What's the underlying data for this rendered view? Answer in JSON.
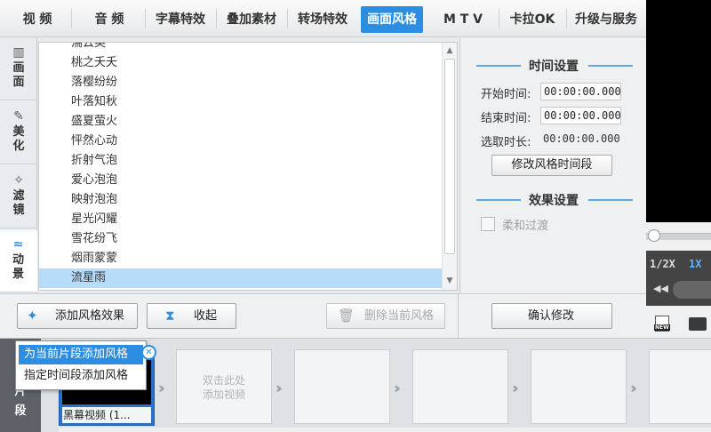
{
  "tabs": [
    {
      "label": "视  频",
      "active": false
    },
    {
      "label": "音  频",
      "active": false
    },
    {
      "label": "字幕特效",
      "active": false
    },
    {
      "label": "叠加素材",
      "active": false
    },
    {
      "label": "转场特效",
      "active": false
    },
    {
      "label": "画面风格",
      "active": true
    },
    {
      "label": "M T V",
      "active": false
    },
    {
      "label": "卡拉OK",
      "active": false
    },
    {
      "label": "升级与服务",
      "active": false
    }
  ],
  "sidenav": [
    {
      "label_1": "画",
      "label_2": "面",
      "icon": "film-icon",
      "glyph": "▥"
    },
    {
      "label_1": "美",
      "label_2": "化",
      "icon": "magic-wand-icon",
      "glyph": "✎"
    },
    {
      "label_1": "滤",
      "label_2": "镜",
      "icon": "sparkle-icon",
      "glyph": "✧"
    },
    {
      "label_1": "动",
      "label_2": "景",
      "icon": "wave-icon",
      "glyph": "≈",
      "active": true
    }
  ],
  "style_list": {
    "items": [
      "湍云英",
      "桃之夭夭",
      "落樱纷纷",
      "叶落知秋",
      "盛夏萤火",
      "怦然心动",
      "折射气泡",
      "爱心泡泡",
      "映射泡泡",
      "星光闪耀",
      "雪花纷飞",
      "烟雨蒙蒙",
      "流星雨"
    ],
    "selected": "流星雨"
  },
  "time_settings": {
    "title": "时间设置",
    "start_label": "开始时间:",
    "start_value": "00:00:00.000",
    "end_label": "结束时间:",
    "end_value": "00:00:00.000",
    "duration_label": "选取时长:",
    "duration_value": "00:00:00.000",
    "modify_button": "修改风格时间段"
  },
  "effect_settings": {
    "title": "效果设置",
    "soft_transition_label": "柔和过渡",
    "soft_transition_checked": false
  },
  "buttons": {
    "add_style": "添加风格效果",
    "collapse": "收起",
    "delete_style": "删除当前风格",
    "confirm": "确认修改"
  },
  "preview": {
    "speed_half": "1/2X",
    "speed_1x": "1X"
  },
  "dropdown": {
    "items": [
      "为当前片段添加风格",
      "指定时间段添加风格"
    ],
    "highlighted_index": 0
  },
  "timeline": {
    "track_label_1": "片",
    "track_label_2": "段",
    "first_clip_label": "黑幕视频 (1...",
    "placeholder_line_1": "双击此处",
    "placeholder_line_2": "添加视频"
  },
  "colors": {
    "accent": "#2d8de0",
    "selected_row": "#b7dcfa"
  }
}
